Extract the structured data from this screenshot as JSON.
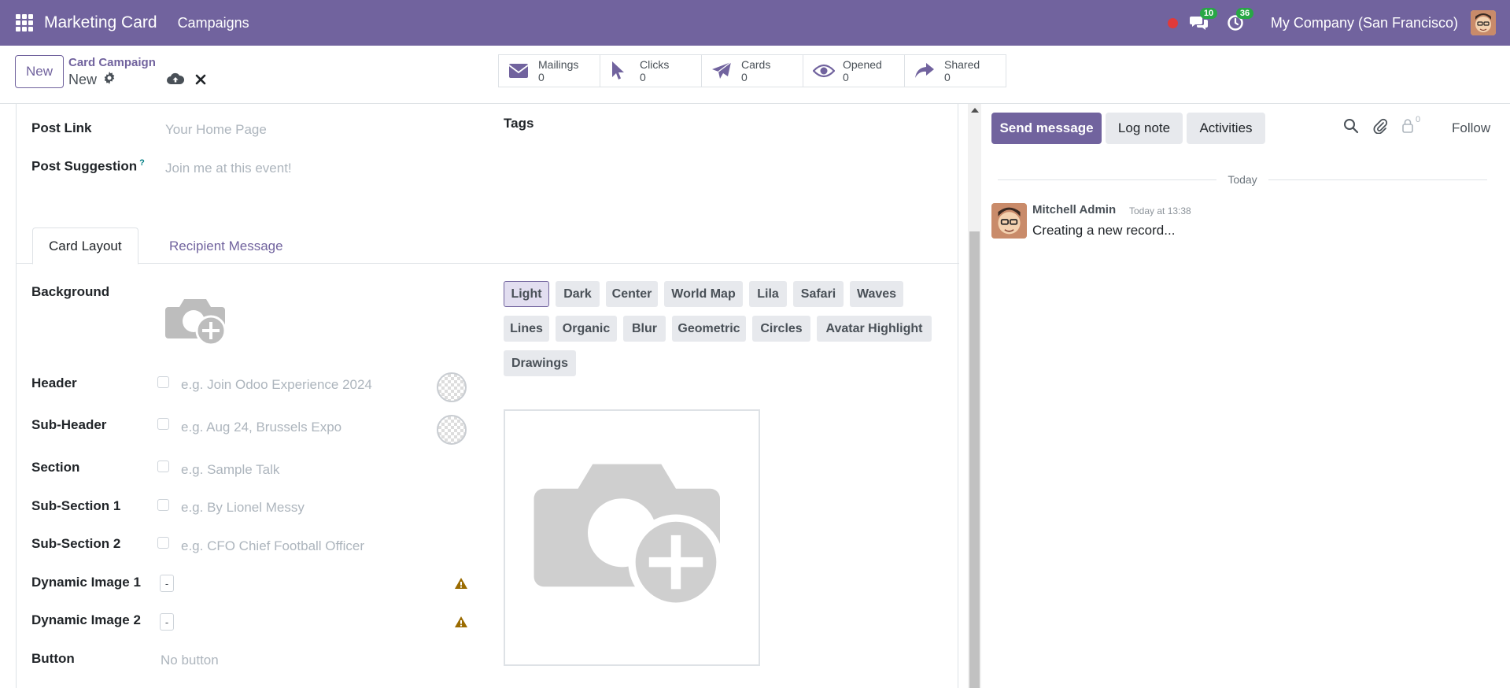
{
  "navbar": {
    "app_name": "Marketing Card",
    "menu_campaigns": "Campaigns",
    "messages_count": "10",
    "activities_count": "36",
    "company": "My Company (San Francisco)"
  },
  "control": {
    "new_label": "New",
    "breadcrumb": "Card Campaign",
    "record_name": "New",
    "stats": [
      {
        "label": "Mailings",
        "value": "0",
        "icon": "envelope-icon"
      },
      {
        "label": "Clicks",
        "value": "0",
        "icon": "pointer-icon"
      },
      {
        "label": "Cards",
        "value": "0",
        "icon": "paper-plane-icon"
      },
      {
        "label": "Opened",
        "value": "0",
        "icon": "eye-icon"
      },
      {
        "label": "Shared",
        "value": "0",
        "icon": "share-icon"
      }
    ]
  },
  "form": {
    "post_link_label": "Post Link",
    "post_link_placeholder": "Your Home Page",
    "post_suggestion_label": "Post Suggestion",
    "post_suggestion_help": "?",
    "post_suggestion_placeholder": "Join me at this event!",
    "tags_label": "Tags",
    "tabs": {
      "card_layout": "Card Layout",
      "recipient_message": "Recipient Message"
    },
    "background_label": "Background",
    "header_label": "Header",
    "header_placeholder": "e.g. Join Odoo Experience 2024",
    "subheader_label": "Sub-Header",
    "subheader_placeholder": "e.g. Aug 24, Brussels Expo",
    "section_label": "Section",
    "section_placeholder": "e.g. Sample Talk",
    "subsection1_label": "Sub-Section 1",
    "subsection1_placeholder": "e.g. By Lionel Messy",
    "subsection2_label": "Sub-Section 2",
    "subsection2_placeholder": "e.g. CFO Chief Football Officer",
    "dynamic1_label": "Dynamic Image 1",
    "dynamic1_value": "-",
    "dynamic2_label": "Dynamic Image 2",
    "dynamic2_value": "-",
    "button_label": "Button",
    "button_placeholder": "No button",
    "layouts": [
      "Light",
      "Dark",
      "Center",
      "World Map",
      "Lila",
      "Safari",
      "Waves",
      "Lines",
      "Organic",
      "Blur",
      "Geometric",
      "Circles",
      "Avatar Highlight",
      "Drawings"
    ],
    "selected_layout": "Light"
  },
  "chatter": {
    "send_message": "Send message",
    "log_note": "Log note",
    "activities": "Activities",
    "followers_count": "0",
    "follow": "Follow",
    "today": "Today",
    "message": {
      "author": "Mitchell Admin",
      "time": "Today at 13:38",
      "body": "Creating a new record..."
    }
  },
  "colors": {
    "brand": "#71639e",
    "badge": "#28a745",
    "record_dot": "#e03a3a",
    "warning": "#9a6b00"
  }
}
